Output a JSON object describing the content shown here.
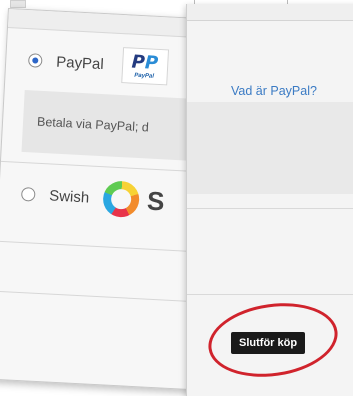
{
  "payment_methods": {
    "paypal": {
      "label": "PayPal",
      "selected": true,
      "logo_text": "PayPal",
      "description": "Betala via PayPal; d"
    },
    "swish": {
      "label": "Swish",
      "selected": false,
      "logo_suffix_text": "S"
    }
  },
  "right_panel": {
    "paypal_info_link": "Vad är PayPal?",
    "finish_button_label": "Slutför köp"
  },
  "colors": {
    "accent_red": "#d0232c",
    "link_blue": "#3b7bc4",
    "button_black": "#1a1a1a"
  },
  "icons": {
    "paypal": "paypal-logo-icon",
    "swish": "swish-logo-icon",
    "highlight": "red-circle-highlight"
  }
}
